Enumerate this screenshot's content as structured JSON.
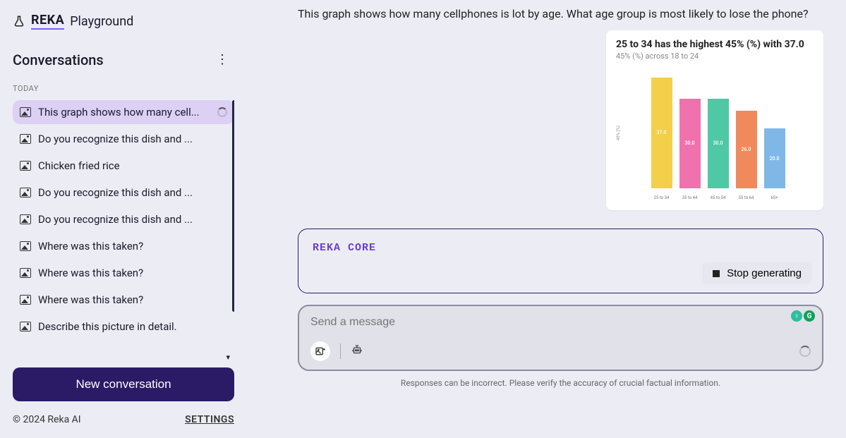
{
  "brand": {
    "name": "REKA",
    "suffix": "Playground"
  },
  "sidebar": {
    "title": "Conversations",
    "date_group": "TODAY",
    "items": [
      {
        "label": "This graph shows how many cell...",
        "active": true,
        "loading": true
      },
      {
        "label": "Do you recognize this dish and ..."
      },
      {
        "label": "Chicken fried rice"
      },
      {
        "label": "Do you recognize this dish and ..."
      },
      {
        "label": "Do you recognize this dish and ..."
      },
      {
        "label": "Where was this taken?"
      },
      {
        "label": "Where was this taken?"
      },
      {
        "label": "Where was this taken?"
      },
      {
        "label": "Describe this picture in detail."
      }
    ],
    "new_button": "New conversation",
    "copyright": "© 2024 Reka AI",
    "settings": "SETTINGS"
  },
  "chat": {
    "user_message": "This graph shows how many cellphones is lot by age. What age group is most likely to lose the phone?",
    "assistant_name": "REKA CORE",
    "stop_label": "Stop generating",
    "input_placeholder": "Send a message",
    "disclaimer": "Responses can be incorrect. Please verify the accuracy of crucial factual information."
  },
  "chart_data": {
    "type": "bar",
    "title": "25 to 34 has the highest 45% (%) with 37.0",
    "subtitle": "45% (%) across 18 to 24",
    "ylabel": "45% (%)",
    "ylim": [
      0,
      40
    ],
    "categories": [
      "25 to 34",
      "35 to 44",
      "45 to 54",
      "55 to 64",
      "65+"
    ],
    "values": [
      37.0,
      30.0,
      30.0,
      26.0,
      20.0
    ],
    "colors": [
      "#f3cf4a",
      "#f072ac",
      "#4fc8a5",
      "#f08a5d",
      "#7fb8e6"
    ]
  }
}
